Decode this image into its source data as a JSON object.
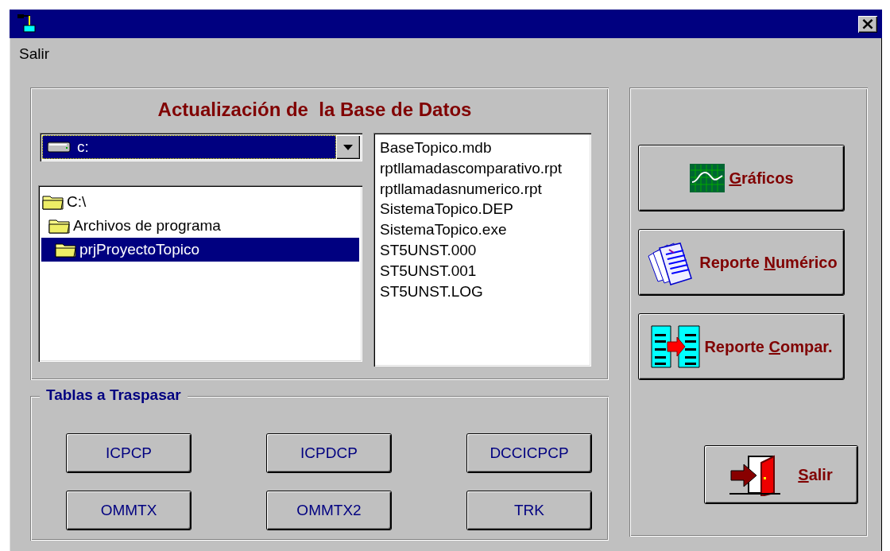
{
  "window": {
    "close": "×"
  },
  "menu": [
    {
      "label": "Salir"
    }
  ],
  "database_panel": {
    "title": "Actualización de  la Base de Datos",
    "drive": {
      "value": "c:"
    },
    "folders": [
      {
        "label": "C:\\",
        "selected": false,
        "children": [
          {
            "label": "Archivos de programa",
            "selected": false,
            "children": [
              {
                "label": "prjProyectoTopico",
                "selected": true
              }
            ]
          }
        ]
      }
    ],
    "files": [
      {
        "label": "BaseTopico.mdb"
      },
      {
        "label": "rptllamadascomparativo.rpt"
      },
      {
        "label": "rptllamadasnumerico.rpt"
      },
      {
        "label": "SistemaTopico.DEP"
      },
      {
        "label": "SistemaTopico.exe"
      },
      {
        "label": "ST5UNST.000"
      },
      {
        "label": "ST5UNST.001"
      },
      {
        "label": "ST5UNST.LOG"
      }
    ]
  },
  "tables_group": {
    "title": "Tablas a Traspasar",
    "buttons": [
      "ICPCP",
      "ICPDCP",
      "DCCICPCP",
      "OMMTX",
      "OMMTX2",
      "TRK"
    ]
  },
  "actions": [
    {
      "kind": "chart",
      "key": "G",
      "after": "ráficos"
    },
    {
      "kind": "report",
      "before": "Reporte ",
      "key": "N",
      "after": "umérico"
    },
    {
      "kind": "compare",
      "before": "Reporte ",
      "key": "C",
      "after": "ompar."
    }
  ],
  "exit": {
    "kind": "door",
    "key": "S",
    "after": "alir"
  }
}
